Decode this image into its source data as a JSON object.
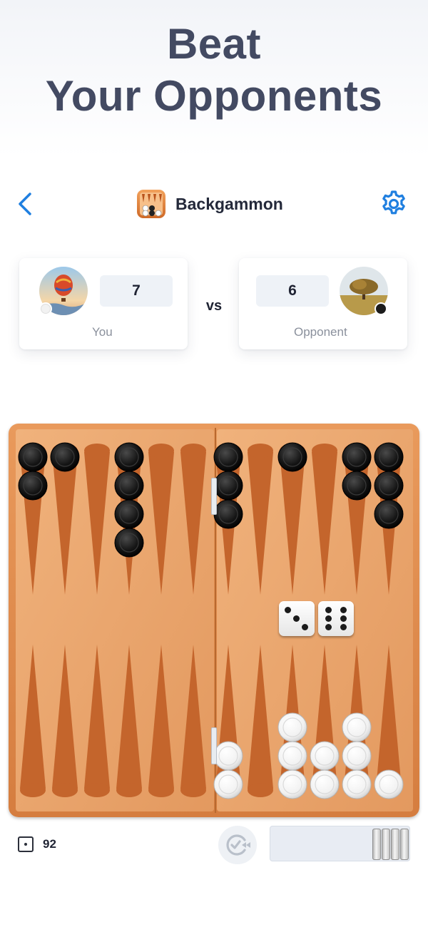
{
  "headline": {
    "line1": "Beat",
    "line2": "Your Opponents"
  },
  "topbar": {
    "back_icon": "chevron-left-icon",
    "title": "Backgammon",
    "app_icon": "backgammon-app-icon",
    "settings_icon": "gear-icon"
  },
  "players": {
    "you": {
      "label": "You",
      "score": "7",
      "avatar": "hot-air-balloon-avatar",
      "piece_color": "white"
    },
    "opponent": {
      "label": "Opponent",
      "score": "6",
      "avatar": "tree-field-avatar",
      "piece_color": "black"
    },
    "vs_label": "vs"
  },
  "board": {
    "colors": {
      "frame": "#d98242",
      "surface": "#e7a66d",
      "point": "#c4652c",
      "checker_black": "#1a1a1a",
      "checker_white": "#f4f4f4"
    },
    "top_points_black_checkers": [
      2,
      1,
      0,
      4,
      0,
      0,
      3,
      0,
      1,
      0,
      2,
      3
    ],
    "bottom_points_white_checkers": [
      0,
      0,
      0,
      0,
      0,
      0,
      2,
      0,
      3,
      2,
      3,
      1
    ],
    "dice": [
      3,
      6
    ]
  },
  "footer": {
    "moves_icon": "die-outline-icon",
    "moves_value": "92",
    "undo_icon": "undo-fast-forward-icon",
    "borne_off_white": 4
  }
}
